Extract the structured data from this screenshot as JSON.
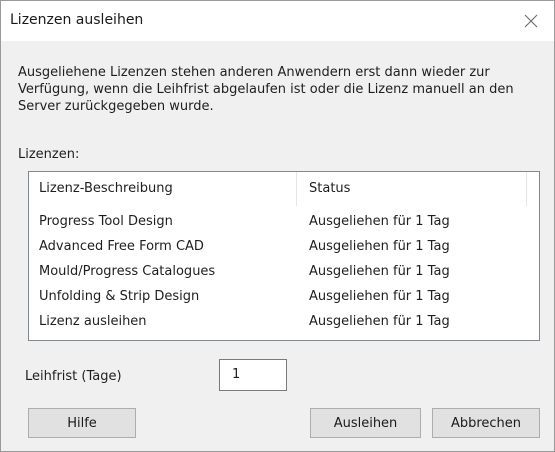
{
  "window": {
    "title": "Lizenzen ausleihen",
    "close_icon": "close-icon"
  },
  "description": "Ausgeliehene Lizenzen stehen anderen Anwendern erst dann wieder zur Verfügung, wenn die Leihfrist abgelaufen ist oder die Lizenz manuell an den Server zurückgegeben wurde.",
  "licenses": {
    "caption": "Lizenzen:",
    "columns": [
      "Lizenz-Beschreibung",
      "Status"
    ],
    "rows": [
      {
        "description": "Progress Tool Design",
        "status": "Ausgeliehen für 1 Tag"
      },
      {
        "description": "Advanced Free Form CAD",
        "status": "Ausgeliehen für 1 Tag"
      },
      {
        "description": "Mould/Progress Catalogues",
        "status": "Ausgeliehen für 1 Tag"
      },
      {
        "description": "Unfolding & Strip Design",
        "status": "Ausgeliehen für 1 Tag"
      },
      {
        "description": "Lizenz ausleihen",
        "status": "Ausgeliehen für 1 Tag"
      }
    ]
  },
  "loan_period": {
    "label": "Leihfrist (Tage)",
    "value": "1"
  },
  "buttons": {
    "help": "Hilfe",
    "lend": "Ausleihen",
    "cancel": "Abbrechen"
  }
}
